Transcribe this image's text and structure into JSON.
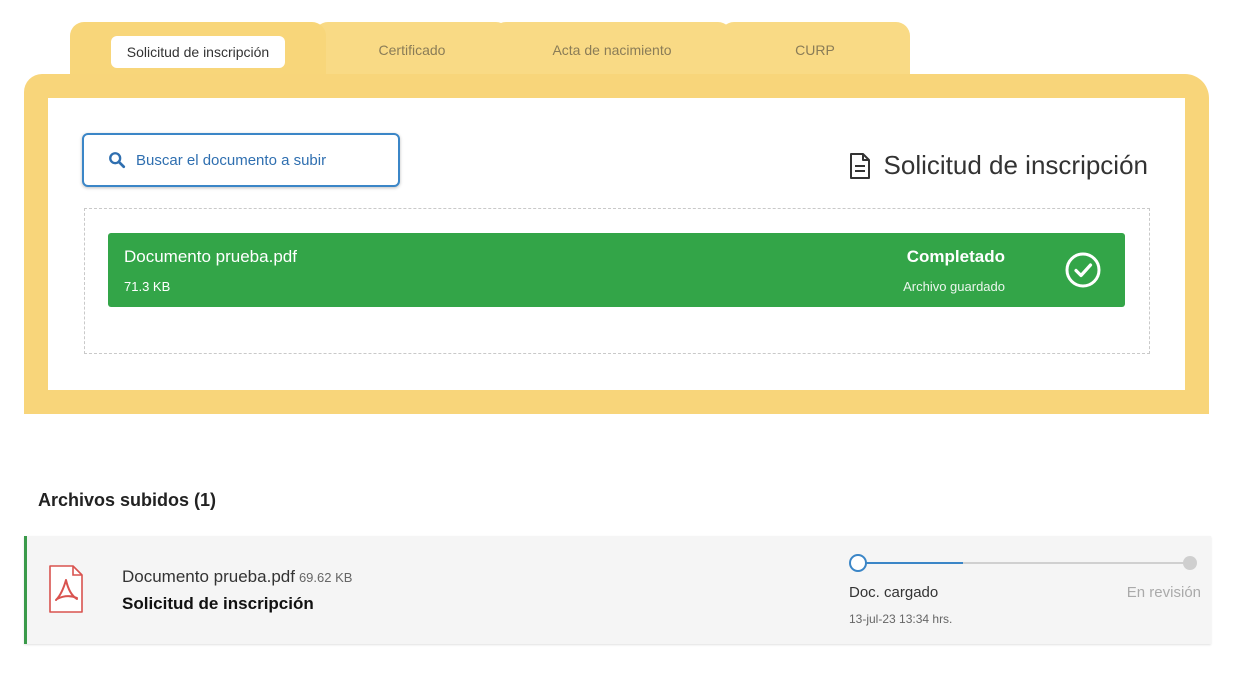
{
  "tabs": [
    {
      "label": "Solicitud de inscripción",
      "active": true
    },
    {
      "label": "Certificado",
      "active": false
    },
    {
      "label": "Acta de nacimiento",
      "active": false
    },
    {
      "label": "CURP",
      "active": false
    }
  ],
  "uploader": {
    "search_button_label": "Buscar el documento a subir",
    "document_title": "Solicitud de inscripción",
    "upload": {
      "file_name": "Documento prueba.pdf",
      "file_size": "71.3 KB",
      "status": "Completado",
      "substatus": "Archivo guardado"
    }
  },
  "uploaded_files": {
    "heading": "Archivos subidos (1)",
    "items": [
      {
        "file_name": "Documento prueba.pdf",
        "file_size": "69.62 KB",
        "document_type": "Solicitud de inscripción",
        "steps": [
          {
            "label": "Doc. cargado",
            "timestamp": "13-jul-23 13:34 hrs.",
            "state": "active"
          },
          {
            "label": "En revisión",
            "state": "pending"
          }
        ]
      }
    ]
  },
  "colors": {
    "tab_yellow": "#f8d57a",
    "accent_blue": "#3b86c7",
    "success_green": "#33a548",
    "pdf_red": "#d9534f"
  },
  "icons": {
    "search": "search-icon",
    "document": "document-icon",
    "check": "check-circle-icon",
    "pdf": "pdf-file-icon"
  }
}
